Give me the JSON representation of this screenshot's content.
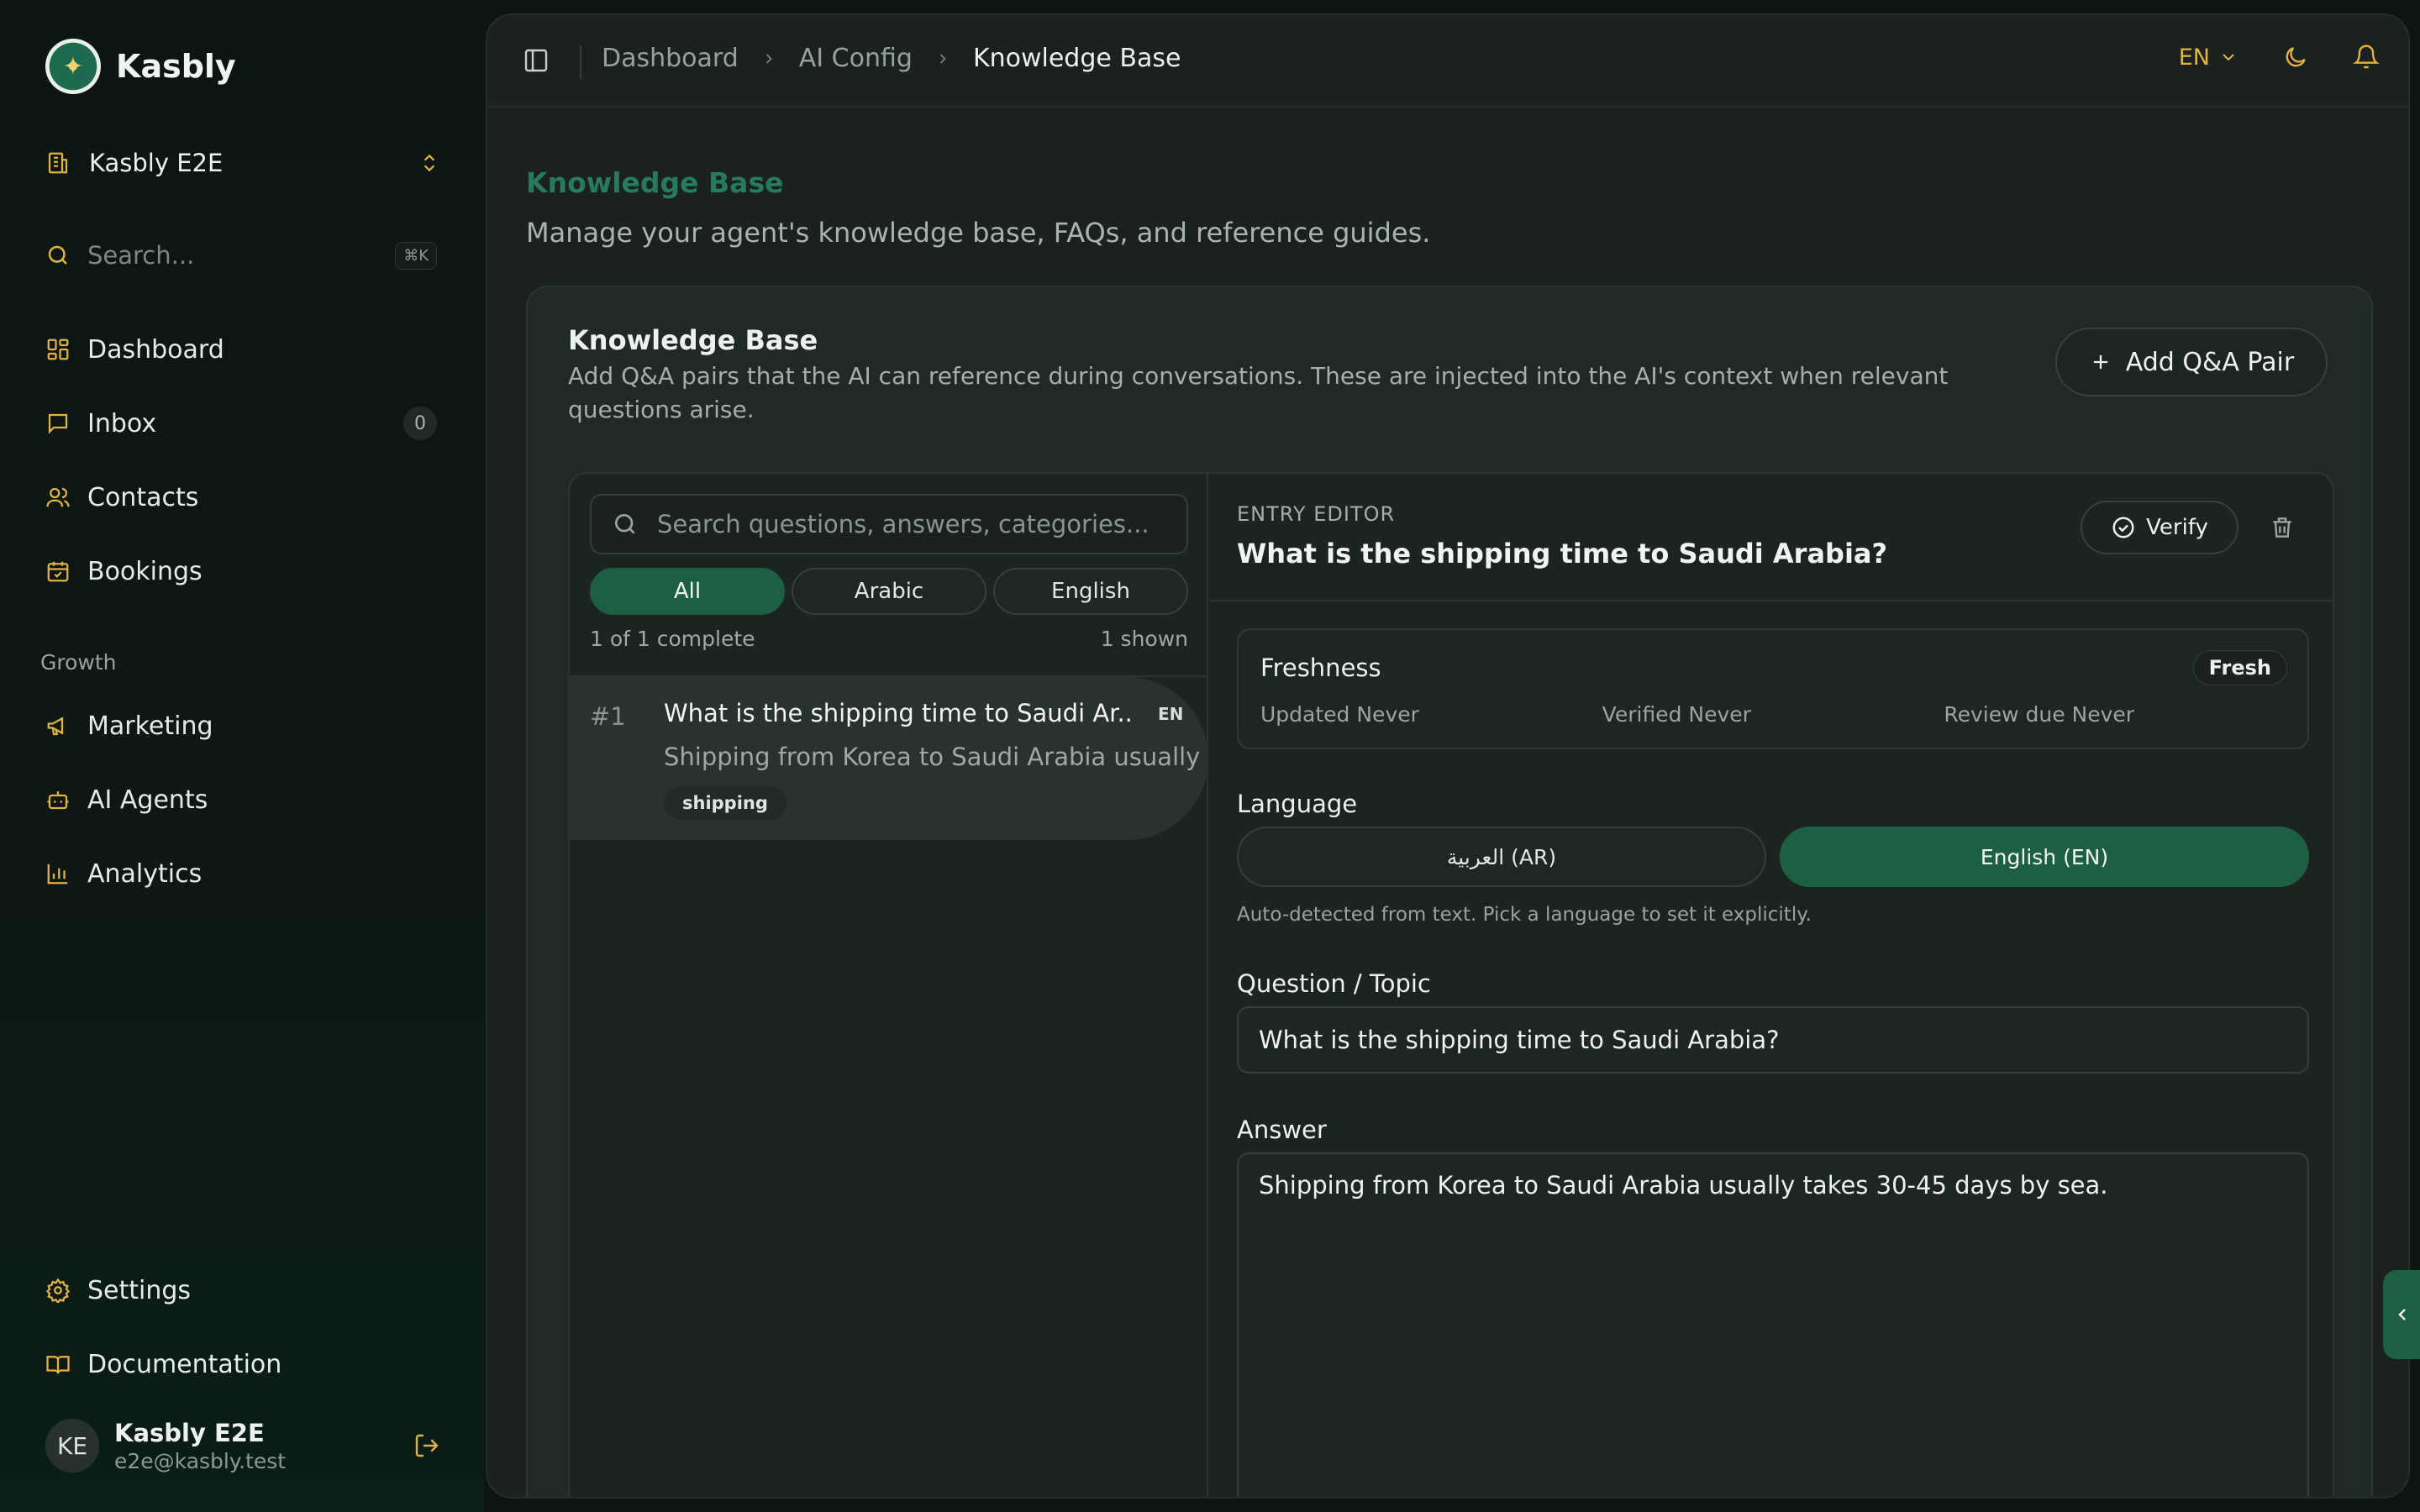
{
  "brand": {
    "name": "Kasbly"
  },
  "org": {
    "name": "Kasbly E2E"
  },
  "sidebar": {
    "search_placeholder": "Search...",
    "search_shortcut": "⌘K",
    "items": [
      {
        "label": "Dashboard",
        "icon": "dashboard-icon"
      },
      {
        "label": "Inbox",
        "icon": "inbox-icon",
        "count": "0"
      },
      {
        "label": "Contacts",
        "icon": "contacts-icon"
      },
      {
        "label": "Bookings",
        "icon": "calendar-icon"
      }
    ],
    "growth_label": "Growth",
    "growth_items": [
      {
        "label": "Marketing",
        "icon": "megaphone-icon"
      },
      {
        "label": "AI Agents",
        "icon": "bot-icon"
      },
      {
        "label": "Analytics",
        "icon": "chart-icon"
      }
    ],
    "bottom_items": [
      {
        "label": "Settings",
        "icon": "gear-icon"
      },
      {
        "label": "Documentation",
        "icon": "book-icon"
      }
    ],
    "user": {
      "initials": "KE",
      "name": "Kasbly E2E",
      "email": "e2e@kasbly.test"
    }
  },
  "topbar": {
    "breadcrumbs": [
      "Dashboard",
      "AI Config",
      "Knowledge Base"
    ],
    "language": "EN"
  },
  "page": {
    "title": "Knowledge Base",
    "subtitle": "Manage your agent's knowledge base, FAQs, and reference guides."
  },
  "card": {
    "title": "Knowledge Base",
    "description": "Add Q&A pairs that the AI can reference during conversations. These are injected into the AI's context when relevant questions arise.",
    "add_button": "Add Q&A Pair"
  },
  "list": {
    "search_placeholder": "Search questions, answers, categories...",
    "filters": [
      "All",
      "Arabic",
      "English"
    ],
    "active_filter": "All",
    "complete_text": "1 of 1 complete",
    "shown_text": "1 shown",
    "entries": [
      {
        "number": "#1",
        "question": "What is the shipping time to Saudi Ar...",
        "lang": "EN",
        "answer": "Shipping from Korea to Saudi Arabia usually",
        "tag": "shipping"
      }
    ]
  },
  "editor": {
    "label": "ENTRY EDITOR",
    "title": "What is the shipping time to Saudi Arabia?",
    "verify_button": "Verify",
    "freshness": {
      "title": "Freshness",
      "badge": "Fresh",
      "updated": "Updated Never",
      "verified": "Verified Never",
      "review": "Review due Never"
    },
    "language_label": "Language",
    "language_options": [
      "العربية (AR)",
      "English (EN)"
    ],
    "active_language": "English (EN)",
    "language_hint": "Auto-detected from text. Pick a language to set it explicitly.",
    "question_label": "Question / Topic",
    "question_value": "What is the shipping time to Saudi Arabia?",
    "answer_label": "Answer",
    "answer_value": "Shipping from Korea to Saudi Arabia usually takes 30-45 days by sea."
  },
  "colors": {
    "accent": "#1d5f45",
    "warning_icon": "#e3b341",
    "page_title": "#287a5c"
  }
}
